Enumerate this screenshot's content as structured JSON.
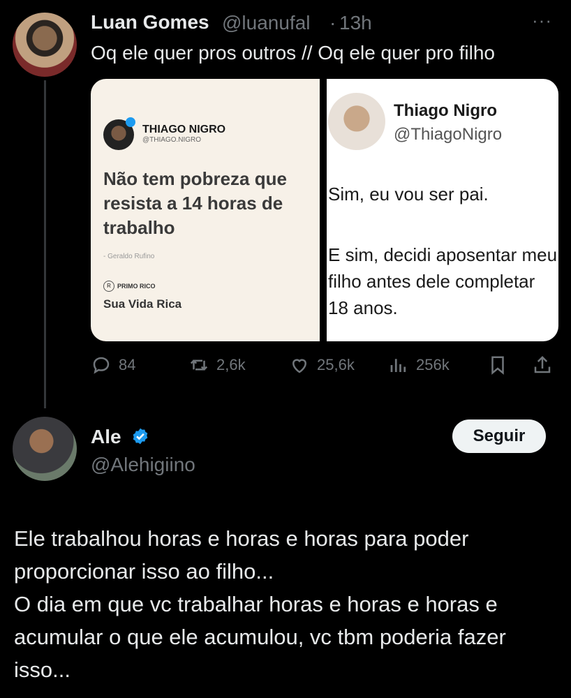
{
  "original": {
    "name": "Luan Gomes",
    "handle": "@luanufal",
    "separator": "·",
    "time": "13h",
    "more_icon": "more-horizontal-icon",
    "text": "Oq ele quer pros outros // Oq ele quer pro filho",
    "media": {
      "left": {
        "author_name": "THIAGO NIGRO",
        "author_handle": "@THIAGO.NIGRO",
        "quote": "Não tem pobreza que resista a 14 horas de trabalho",
        "quote_author": "- Geraldo Rufino",
        "brand_icon": "R",
        "brand_label": "PRIMO RICO",
        "brand_sub": "Sua Vida Rica"
      },
      "right": {
        "author_name": "Thiago Nigro",
        "author_handle": "@ThiagoNigro",
        "line1": "Sim, eu vou ser pai.",
        "line2": "E sim, decidi aposentar meu filho antes dele completar 18 anos."
      }
    },
    "actions": {
      "replies": "84",
      "reposts": "2,6k",
      "likes": "25,6k",
      "views": "256k"
    }
  },
  "reply": {
    "name": "Ale",
    "verified_icon": "verified-badge-icon",
    "handle": "@Alehigiino",
    "follow_label": "Seguir",
    "paragraph1": "Ele trabalhou horas e horas e horas para poder proporcionar isso ao filho...",
    "paragraph2": "O dia em que vc trabalhar horas e horas e horas e acumular o que ele acumulou, vc tbm poderia fazer isso..."
  },
  "colors": {
    "background": "#000000",
    "text": "#e7e9ea",
    "muted": "#71767b",
    "verified": "#1d9bf0"
  }
}
